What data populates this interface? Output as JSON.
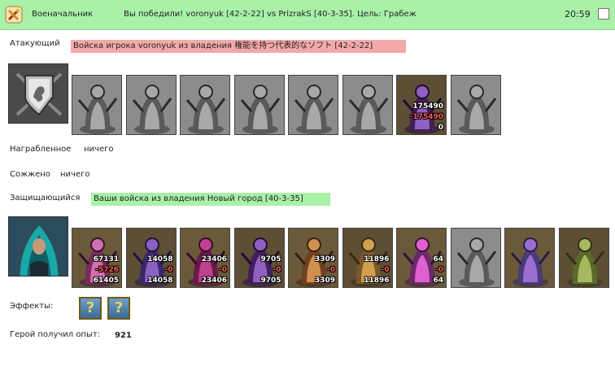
{
  "header": {
    "category": "Военачальник",
    "message": "Вы победили! voronyuk [42-2-22] vs PrizrakS [40-3-35]. Цель: Грабеж",
    "time": "20:59"
  },
  "attacker": {
    "label": "Атакующий",
    "banner": "Войска игрока voronyuk из владения 権能を持つ代表的なソフト [42-2-22]",
    "units": [
      {
        "icon": "knight-unit-icon",
        "tint": "gray"
      },
      {
        "icon": "archer-unit-icon",
        "tint": "gray"
      },
      {
        "icon": "cavalry-unit-icon",
        "tint": "gray"
      },
      {
        "icon": "griffin-unit-icon",
        "tint": "gray"
      },
      {
        "icon": "crossbowman-unit-icon",
        "tint": "gray"
      },
      {
        "icon": "monk-unit-icon",
        "tint": "gray"
      },
      {
        "icon": "angel-unit-icon",
        "tint": "color",
        "counts": [
          "175490",
          "-175490",
          "0"
        ]
      },
      {
        "icon": "wraith-unit-icon",
        "tint": "gray"
      }
    ]
  },
  "loot": {
    "label": "Награбленное",
    "value": "ничего"
  },
  "burned": {
    "label": "Сожжено",
    "value": "ничего"
  },
  "defender": {
    "label": "Защищающийся",
    "banner": "Ваши войска из владения Новый город [40-3-35]",
    "units": [
      {
        "icon": "minotaur-unit-icon",
        "tint": "color",
        "counts": [
          "67131",
          "-5726",
          "61405"
        ]
      },
      {
        "icon": "dark-elf-unit-icon",
        "tint": "color",
        "counts": [
          "14058",
          "-0",
          "14058"
        ]
      },
      {
        "icon": "lizard-rider-unit-icon",
        "tint": "color",
        "counts": [
          "23406",
          "-0",
          "23406"
        ]
      },
      {
        "icon": "fury-unit-icon",
        "tint": "color",
        "counts": [
          "9705",
          "-0",
          "9705"
        ]
      },
      {
        "icon": "shadow-archer-unit-icon",
        "tint": "color",
        "counts": [
          "3309",
          "-0",
          "3309"
        ]
      },
      {
        "icon": "warlock-unit-icon",
        "tint": "color",
        "counts": [
          "11896",
          "-0",
          "11896"
        ]
      },
      {
        "icon": "shadow-witch-unit-icon",
        "tint": "color",
        "counts": [
          "64",
          "-0",
          "64"
        ]
      },
      {
        "icon": "black-dragon-unit-icon",
        "tint": "gray"
      },
      {
        "icon": "egg-nest-unit-icon",
        "tint": "color"
      },
      {
        "icon": "crystal-pod-unit-icon",
        "tint": "color"
      }
    ]
  },
  "effects": {
    "label": "Эффекты:",
    "items": [
      "?",
      "?"
    ]
  },
  "xp": {
    "label": "Герой получил опыт:",
    "value": "921"
  },
  "colors": {
    "header_bg": "#a9f0a9",
    "attacker_banner": "#f4a9a9",
    "defender_banner": "#a9f0a9",
    "loss_red": "#ff5a5a"
  }
}
